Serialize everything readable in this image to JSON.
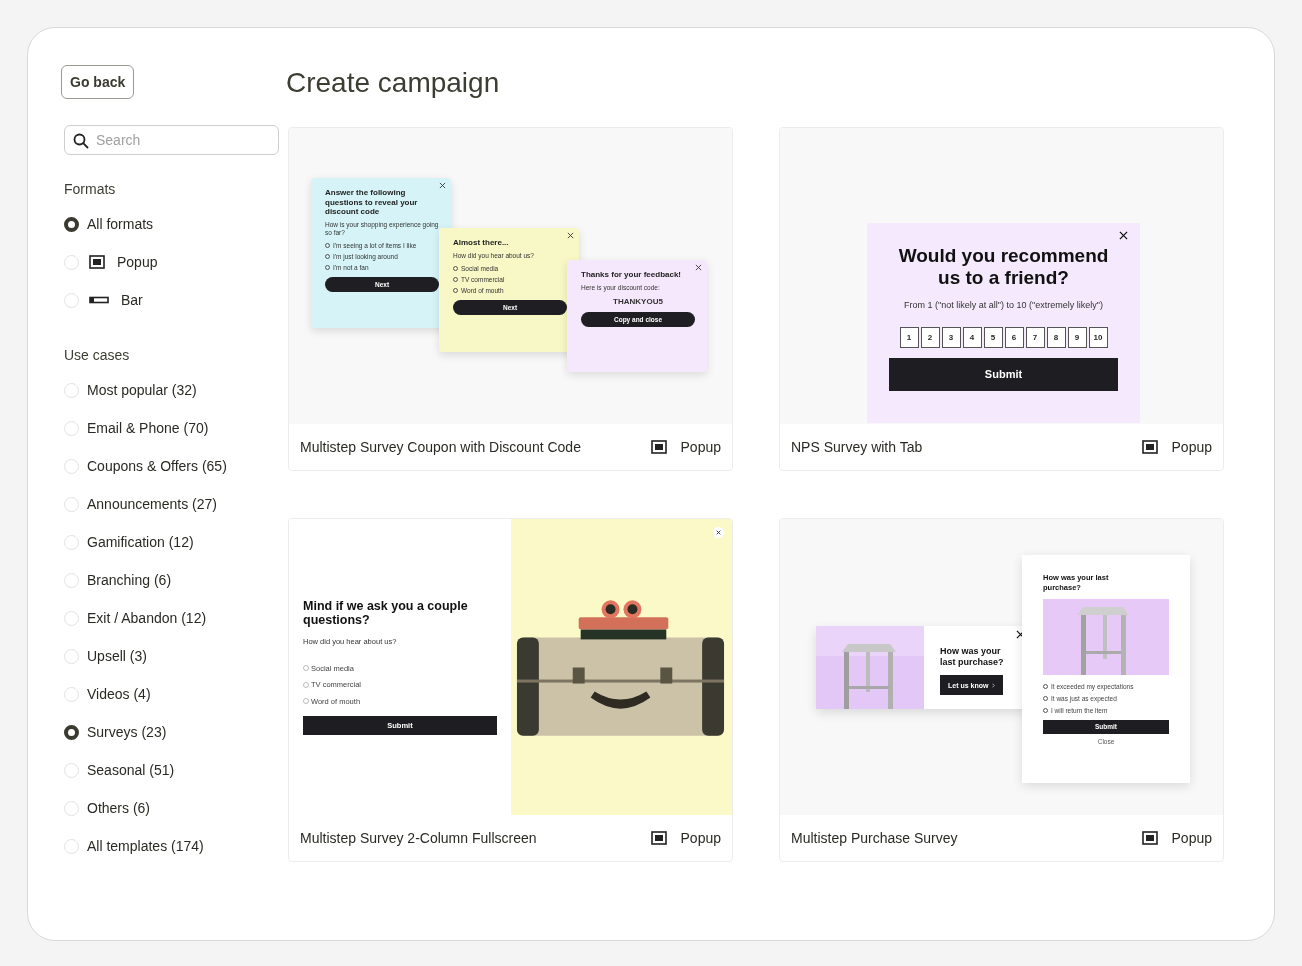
{
  "back_button": "Go back",
  "search": {
    "placeholder": "Search"
  },
  "formats": {
    "heading": "Formats",
    "items": [
      {
        "label": "All formats",
        "kind": "all",
        "selected": true
      },
      {
        "label": "Popup",
        "kind": "popup",
        "selected": false
      },
      {
        "label": "Bar",
        "kind": "bar",
        "selected": false
      }
    ]
  },
  "use_cases": {
    "heading": "Use cases",
    "items": [
      {
        "label": "Most popular (32)",
        "selected": false
      },
      {
        "label": "Email & Phone (70)",
        "selected": false
      },
      {
        "label": "Coupons & Offers (65)",
        "selected": false
      },
      {
        "label": "Announcements (27)",
        "selected": false
      },
      {
        "label": "Gamification (12)",
        "selected": false
      },
      {
        "label": "Branching (6)",
        "selected": false
      },
      {
        "label": "Exit / Abandon (12)",
        "selected": false
      },
      {
        "label": "Upsell (3)",
        "selected": false
      },
      {
        "label": "Videos (4)",
        "selected": false
      },
      {
        "label": "Surveys (23)",
        "selected": true
      },
      {
        "label": "Seasonal (51)",
        "selected": false
      },
      {
        "label": "Others (6)",
        "selected": false
      },
      {
        "label": "All templates (174)",
        "selected": false
      }
    ]
  },
  "title": "Create campaign",
  "templates": [
    {
      "name": "Multistep Survey Coupon with Discount Code",
      "format": "Popup",
      "preview": {
        "kind": "multistep",
        "steps": [
          {
            "kind": "question",
            "color": "#d6f4f7",
            "title": "Answer the following questions to reveal your discount code",
            "question": "How is your shopping experience going so far?",
            "options": [
              "I'm seeing a lot of items I like",
              "I'm just looking around",
              "I'm not a fan"
            ],
            "button": "Next"
          },
          {
            "kind": "question",
            "color": "#f8f8c6",
            "title": "Almost there...",
            "question": "How did you hear about us?",
            "options": [
              "Social media",
              "TV commercial",
              "Word of mouth"
            ],
            "button": "Next"
          },
          {
            "kind": "code",
            "color": "#f6e8fc",
            "title": "Thanks for your feedback!",
            "question": "Here is your discount code:",
            "code": "THANKYOU5",
            "button": "Copy and close"
          }
        ]
      }
    },
    {
      "name": "NPS Survey with Tab",
      "format": "Popup",
      "preview": {
        "kind": "nps",
        "title": "Would you recommend us to a friend?",
        "subtitle": "From 1 (\"not likely at all\") to 10 (\"extremely likely\")",
        "scale": [
          "1",
          "2",
          "3",
          "4",
          "5",
          "6",
          "7",
          "8",
          "9",
          "10"
        ],
        "button": "Submit"
      }
    },
    {
      "name": "Multistep Survey 2-Column Fullscreen",
      "format": "Popup",
      "preview": {
        "kind": "fullscreen",
        "title": "Mind if we ask you a couple questions?",
        "question": "How did you hear about us?",
        "options": [
          "Social media",
          "TV commercial",
          "Word of mouth"
        ],
        "button": "Submit"
      }
    },
    {
      "name": "Multistep Purchase Survey",
      "format": "Popup",
      "preview": {
        "kind": "purchase",
        "bar": {
          "title": "How was your last purchase?",
          "button": "Let us know"
        },
        "popup": {
          "title": "How was your last purchase?",
          "options": [
            "It exceeded my expectations",
            "It was just as expected",
            "I will return the item"
          ],
          "button": "Submit",
          "close": "Close"
        }
      }
    }
  ]
}
